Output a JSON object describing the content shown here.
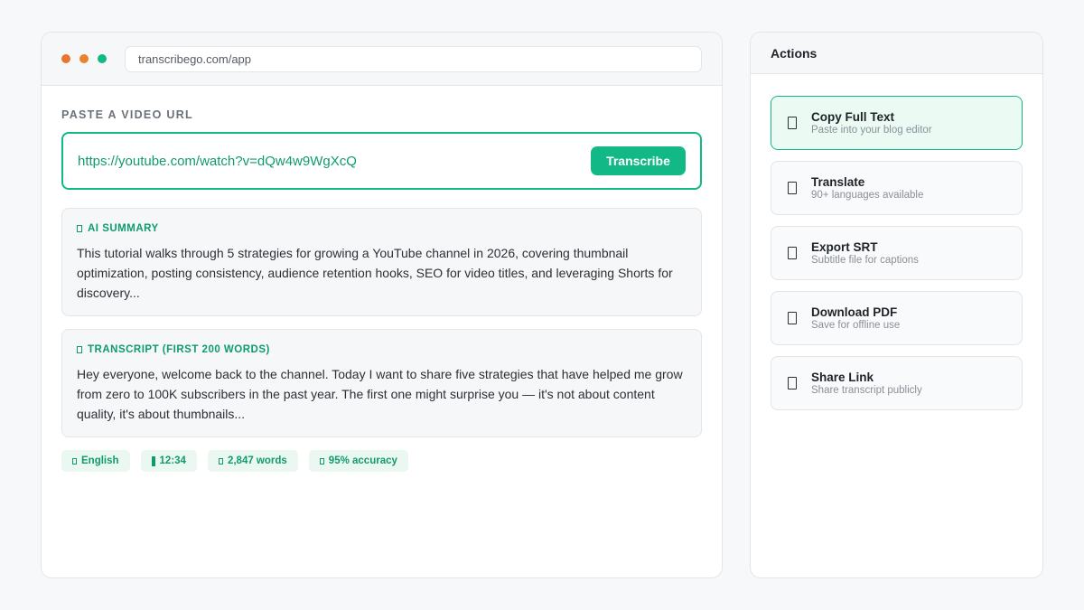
{
  "browser": {
    "address": "transcribego.com/app"
  },
  "main": {
    "section_label": "PASTE A VIDEO URL",
    "url_value": "https://youtube.com/watch?v=dQw4w9WgXcQ",
    "transcribe_label": "Transcribe",
    "summary": {
      "heading": "AI SUMMARY",
      "text": "This tutorial walks through 5 strategies for growing a YouTube channel in 2026, covering thumbnail optimization, posting consistency, audience retention hooks, SEO for video titles, and leveraging Shorts for discovery..."
    },
    "transcript": {
      "heading": "TRANSCRIPT (FIRST 200 WORDS)",
      "text": "Hey everyone, welcome back to the channel. Today I want to share five strategies that have helped me grow from zero to 100K subscribers in the past year. The first one might surprise you — it's not about content quality, it's about thumbnails..."
    },
    "tags": [
      {
        "label": "English",
        "icon": "globe-icon"
      },
      {
        "label": "12:34",
        "icon": "clock-icon"
      },
      {
        "label": "2,847 words",
        "icon": "document-icon"
      },
      {
        "label": "95% accuracy",
        "icon": "check-icon"
      }
    ]
  },
  "panel": {
    "title": "Actions",
    "actions": [
      {
        "title": "Copy Full Text",
        "subtitle": "Paste into your blog editor",
        "icon": "copy-icon",
        "active": true
      },
      {
        "title": "Translate",
        "subtitle": "90+ languages available",
        "icon": "translate-icon"
      },
      {
        "title": "Export SRT",
        "subtitle": "Subtitle file for captions",
        "icon": "export-icon"
      },
      {
        "title": "Download PDF",
        "subtitle": "Save for offline use",
        "icon": "download-icon"
      },
      {
        "title": "Share Link",
        "subtitle": "Share transcript publicly",
        "icon": "share-icon"
      }
    ]
  },
  "colors": {
    "accent": "#12b886",
    "accent_text": "#0f9b6e",
    "window_dot_1": "#e8772e",
    "window_dot_2": "#e8832e",
    "window_dot_3": "#12b886"
  }
}
